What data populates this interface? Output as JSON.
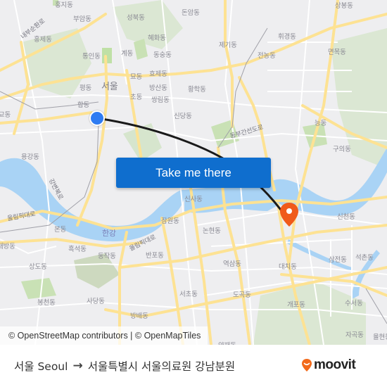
{
  "map": {
    "colors": {
      "background": "#eeeef0",
      "water": "#a9d3f5",
      "park": "#cfe3c0",
      "forest": "#d6e5cd",
      "major_road": "#fde293",
      "minor_road": "#ffffff",
      "route": "#1a1a1a",
      "origin_marker": "#2f7cf2",
      "destination_marker": "#f05a1a",
      "cta_button": "#0f6ece"
    },
    "labels": [
      {
        "text": "홍지동",
        "kind": "district"
      },
      {
        "text": "부암동",
        "kind": "district"
      },
      {
        "text": "성북동",
        "kind": "district"
      },
      {
        "text": "돈암동",
        "kind": "district"
      },
      {
        "text": "상봉동",
        "kind": "district"
      },
      {
        "text": "내부순환로",
        "kind": "road"
      },
      {
        "text": "홍제동",
        "kind": "district"
      },
      {
        "text": "혜화동",
        "kind": "district"
      },
      {
        "text": "제기동",
        "kind": "district"
      },
      {
        "text": "휘경동",
        "kind": "district"
      },
      {
        "text": "통인동",
        "kind": "district"
      },
      {
        "text": "계동",
        "kind": "district"
      },
      {
        "text": "동숭동",
        "kind": "district"
      },
      {
        "text": "전농동",
        "kind": "district"
      },
      {
        "text": "면목동",
        "kind": "district"
      },
      {
        "text": "묘동",
        "kind": "district"
      },
      {
        "text": "효제동",
        "kind": "district"
      },
      {
        "text": "평동",
        "kind": "district"
      },
      {
        "text": "서울",
        "kind": "city"
      },
      {
        "text": "방산동",
        "kind": "district"
      },
      {
        "text": "황학동",
        "kind": "district"
      },
      {
        "text": "초동",
        "kind": "district"
      },
      {
        "text": "쌍림동",
        "kind": "district"
      },
      {
        "text": "합동",
        "kind": "district"
      },
      {
        "text": "신당동",
        "kind": "district"
      },
      {
        "text": "교동",
        "kind": "district"
      },
      {
        "text": "능동",
        "kind": "district"
      },
      {
        "text": "동부간선도로",
        "kind": "road"
      },
      {
        "text": "구의동",
        "kind": "district"
      },
      {
        "text": "용강동",
        "kind": "district"
      },
      {
        "text": "강변북로",
        "kind": "road"
      },
      {
        "text": "신사동",
        "kind": "district"
      },
      {
        "text": "올림픽대로",
        "kind": "road"
      },
      {
        "text": "신천동",
        "kind": "district"
      },
      {
        "text": "잠원동",
        "kind": "district"
      },
      {
        "text": "본동",
        "kind": "district"
      },
      {
        "text": "한강",
        "kind": "water"
      },
      {
        "text": "논현동",
        "kind": "district"
      },
      {
        "text": "올림픽대로",
        "kind": "road"
      },
      {
        "text": "흑석동",
        "kind": "district"
      },
      {
        "text": "동작동",
        "kind": "district"
      },
      {
        "text": "반포동",
        "kind": "district"
      },
      {
        "text": "대방동",
        "kind": "district"
      },
      {
        "text": "삼전동",
        "kind": "district"
      },
      {
        "text": "석촌동",
        "kind": "district"
      },
      {
        "text": "상도동",
        "kind": "district"
      },
      {
        "text": "역삼동",
        "kind": "district"
      },
      {
        "text": "대치동",
        "kind": "district"
      },
      {
        "text": "서초동",
        "kind": "district"
      },
      {
        "text": "도곡동",
        "kind": "district"
      },
      {
        "text": "사당동",
        "kind": "district"
      },
      {
        "text": "봉천동",
        "kind": "district"
      },
      {
        "text": "개포동",
        "kind": "district"
      },
      {
        "text": "수서동",
        "kind": "district"
      },
      {
        "text": "방배동",
        "kind": "district"
      },
      {
        "text": "자곡동",
        "kind": "district"
      },
      {
        "text": "율현동",
        "kind": "district"
      },
      {
        "text": "양재동",
        "kind": "district"
      }
    ],
    "attribution": "© OpenStreetMap contributors | © OpenMapTiles",
    "cta_label": "Take me there"
  },
  "footer": {
    "origin": "서울 Seoul",
    "arrow_icon": "right-arrow-icon",
    "destination": "서울특별시 서울의료원 강남분원",
    "logo_text": "moovit"
  }
}
